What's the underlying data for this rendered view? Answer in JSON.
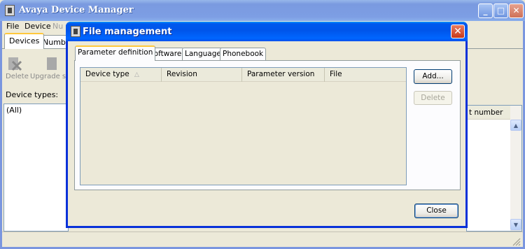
{
  "main_window": {
    "title": "Avaya Device Manager",
    "menu": [
      "File",
      "Device",
      "Nu"
    ],
    "tabs": [
      "Devices",
      "Numbers"
    ],
    "toolbar": {
      "delete_label": "Delete",
      "upgrade_label": "Upgrade sc"
    },
    "device_types_label": "Device types:",
    "device_types_items": [
      "(All)"
    ],
    "right_column_header": "t number",
    "caption_buttons": {
      "minimize": "_",
      "maximize": "□",
      "close": "✕"
    }
  },
  "dialog": {
    "title": "File management",
    "close_glyph": "✕",
    "tabs": [
      "Parameter definition",
      "Software",
      "Language",
      "Phonebook"
    ],
    "selected_tab": "Parameter definition",
    "columns": [
      "Device type",
      "Revision",
      "Parameter version",
      "File"
    ],
    "sort_indicator": "△",
    "rows": [],
    "add_button": "Add...",
    "delete_button": "Delete",
    "close_button": "Close"
  },
  "colors": {
    "titlebar_active": "#0058ee",
    "titlebar_inactive": "#7d9ee4",
    "close_red": "#c8381a",
    "face": "#ece9d8",
    "tab_highlight": "#ffc83c"
  }
}
